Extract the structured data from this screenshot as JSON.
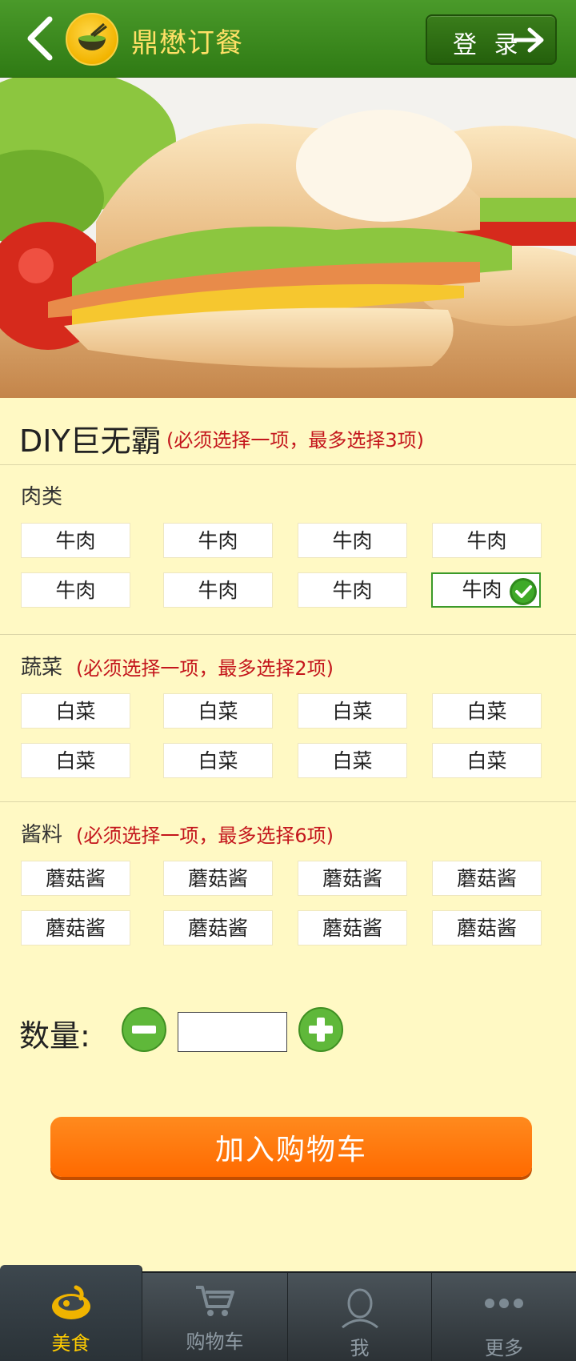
{
  "header": {
    "app_title": "鼎懋订餐",
    "login_label": "登 录"
  },
  "product": {
    "title": "DIY巨无霸",
    "note": "(必须选择一项，最多选择3项)"
  },
  "sections": {
    "meat": {
      "title": "肉类",
      "options": [
        "牛肉",
        "牛肉",
        "牛肉",
        "牛肉",
        "牛肉",
        "牛肉",
        "牛肉",
        "牛肉"
      ],
      "selected_index": 7
    },
    "veg": {
      "title": "蔬菜",
      "note": "(必须选择一项，最多选择2项)",
      "options": [
        "白菜",
        "白菜",
        "白菜",
        "白菜",
        "白菜",
        "白菜",
        "白菜",
        "白菜"
      ]
    },
    "sauce": {
      "title": "酱料",
      "note": "(必须选择一项，最多选择6项)",
      "options": [
        "蘑菇酱",
        "蘑菇酱",
        "蘑菇酱",
        "蘑菇酱",
        "蘑菇酱",
        "蘑菇酱",
        "蘑菇酱",
        "蘑菇酱"
      ]
    }
  },
  "quantity": {
    "label": "数量:",
    "value": ""
  },
  "cart_button": "加入购物车",
  "tabs": [
    {
      "label": "美食",
      "icon": "food-icon",
      "active": true
    },
    {
      "label": "购物车",
      "icon": "cart-icon",
      "active": false
    },
    {
      "label": "我",
      "icon": "user-icon",
      "active": false
    },
    {
      "label": "更多",
      "icon": "more-icon",
      "active": false
    }
  ],
  "colors": {
    "header_green": "#2f7a14",
    "title_yellow": "#ffe066",
    "note_red": "#c4161c",
    "background": "#fff9c4",
    "cart_orange": "#ff6a00",
    "active_tab": "#ffcc00"
  }
}
